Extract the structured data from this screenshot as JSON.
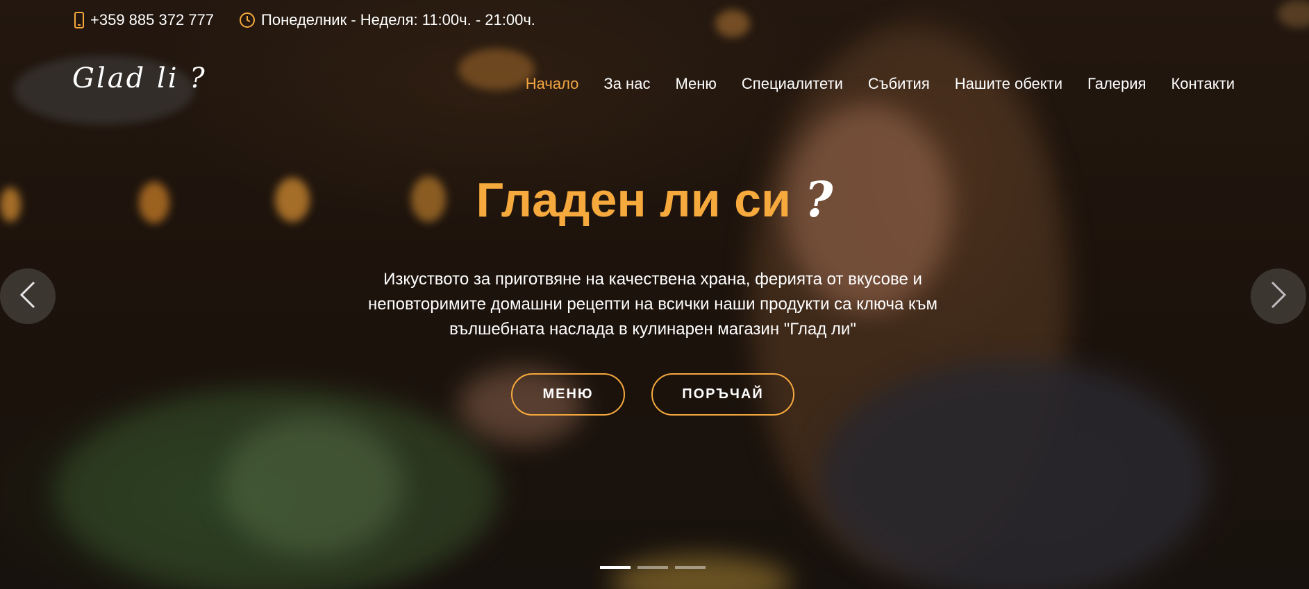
{
  "topbar": {
    "phone": "+359 885 372 777",
    "hours": "Понеделник - Неделя: 11:00ч. - 21:00ч.",
    "phone_icon": "phone-icon",
    "clock_icon": "clock-icon"
  },
  "header": {
    "logo": "Glad li ?",
    "nav": [
      {
        "label": "Начало",
        "active": true
      },
      {
        "label": "За нас"
      },
      {
        "label": "Меню"
      },
      {
        "label": "Специалитети"
      },
      {
        "label": "Събития"
      },
      {
        "label": "Нашите обекти"
      },
      {
        "label": "Галерия"
      },
      {
        "label": "Контакти"
      }
    ]
  },
  "hero": {
    "headline": "Гладен ли си",
    "headline_mark": "?",
    "lead": "Изкуството за приготвяне на качествена храна, ферията от вкусове и неповторимите домашни рецепти на всички наши продукти са ключа към вълшебната наслада в кулинарен магазин \"Глад ли\"",
    "buttons": {
      "menu": "МЕНЮ",
      "order": "ПОРЪЧАЙ"
    }
  },
  "carousel": {
    "prev_icon": "chevron-left-icon",
    "next_icon": "chevron-right-icon",
    "slide_count": 3,
    "active_slide": 1
  },
  "colors": {
    "accent": "#f6a93d",
    "active_nav": "#f2a541",
    "text": "#ffffff"
  }
}
